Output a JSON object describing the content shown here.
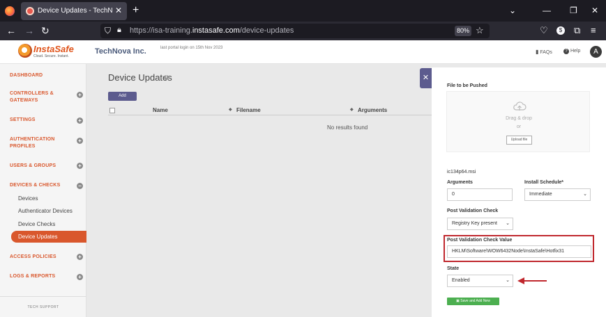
{
  "browser": {
    "tab_title": "Device Updates - TechNova Inc.",
    "url_prefix": "https://isa-training.",
    "url_domain": "instasafe.com",
    "url_path": "/device-updates",
    "zoom": "80%"
  },
  "header": {
    "logo_text": "InstaSafe",
    "logo_tagline": "Cloud. Secure. Instant.",
    "company": "TechNova Inc.",
    "last_login": "last portal login on 15th Nov 2023",
    "faqs": "FAQs",
    "help": "Help",
    "avatar": "A"
  },
  "sidebar": {
    "items": [
      {
        "label": "DASHBOARD"
      },
      {
        "label": "CONTROLLERS & GATEWAYS"
      },
      {
        "label": "SETTINGS"
      },
      {
        "label": "AUTHENTICATION PROFILES"
      },
      {
        "label": "USERS & GROUPS"
      },
      {
        "label": "DEVICES & CHECKS"
      },
      {
        "label": "ACCESS POLICIES"
      },
      {
        "label": "LOGS & REPORTS"
      }
    ],
    "sub_items": [
      {
        "label": "Devices"
      },
      {
        "label": "Authenticator Devices"
      },
      {
        "label": "Device Checks"
      },
      {
        "label": "Device Updates"
      }
    ],
    "footer": "TECH SUPPORT"
  },
  "main": {
    "title": "Device Updates",
    "add_label": "Add",
    "columns": [
      "Name",
      "Filename",
      "Arguments"
    ],
    "empty": "No results found"
  },
  "panel": {
    "file_label": "File to be Pushed",
    "drag_drop": "Drag & drop",
    "or": "or",
    "upload": "Upload file",
    "filename": "ic134p64.msi",
    "arguments_label": "Arguments",
    "arguments_value": "0",
    "schedule_label": "Install Schedule*",
    "schedule_value": "Immediate",
    "pvc_label": "Post Validation Check",
    "pvc_value": "Registry Key present",
    "pvcv_label": "Post Validation Check Value",
    "pvcv_value": "HKLM\\Software\\WOW6432Node\\InstaSafe\\Hotfix31",
    "state_label": "State",
    "state_value": "Enabled",
    "save_label": "Save and Add New"
  }
}
